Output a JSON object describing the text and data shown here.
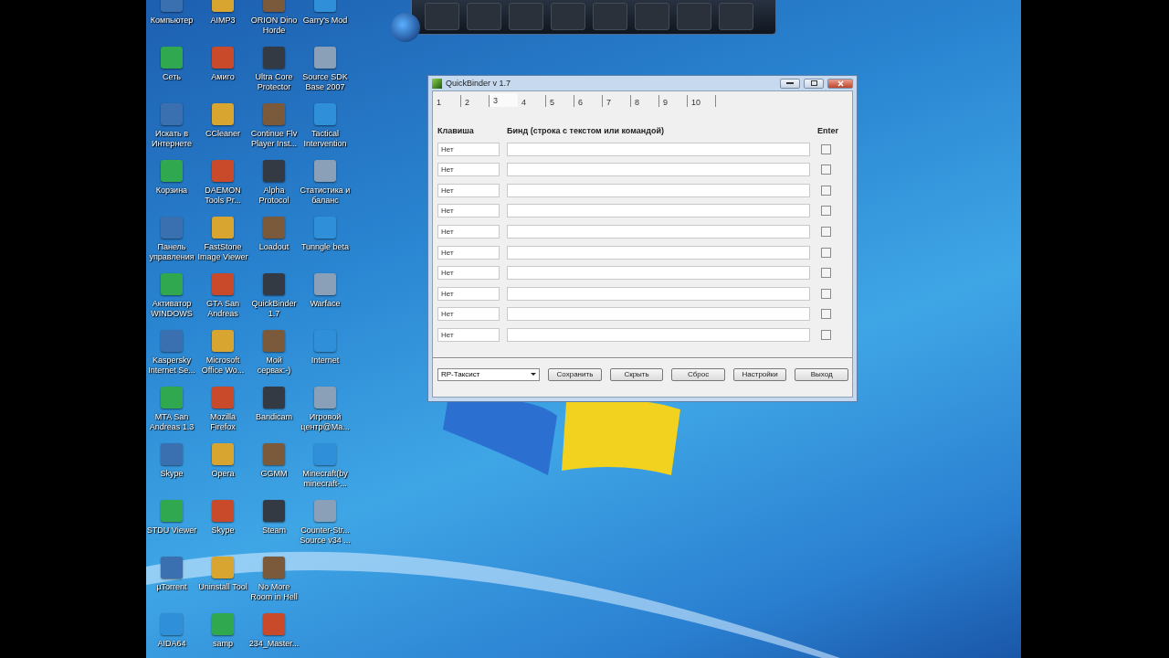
{
  "desktop": {
    "icon_rows": [
      [
        {
          "label": "Компьютер"
        },
        {
          "label": "AIMP3"
        },
        {
          "label": "ORION Dino Horde"
        },
        {
          "label": "Garry's Mod"
        }
      ],
      [
        {
          "label": "Сеть"
        },
        {
          "label": "Амиго"
        },
        {
          "label": "Ultra Core Protector"
        },
        {
          "label": "Source SDK Base 2007"
        }
      ],
      [
        {
          "label": "Искать в Интернете"
        },
        {
          "label": "CCleaner"
        },
        {
          "label": "Continue Flv Player Inst..."
        },
        {
          "label": "Tactical Intervention"
        }
      ],
      [
        {
          "label": "Корзина"
        },
        {
          "label": "DAEMON Tools Pr..."
        },
        {
          "label": "Alpha Protocol"
        },
        {
          "label": "Статистика и баланс"
        }
      ],
      [
        {
          "label": "Панель управления"
        },
        {
          "label": "FastStone Image Viewer"
        },
        {
          "label": "Loadout"
        },
        {
          "label": "Tunngle beta"
        }
      ],
      [
        {
          "label": "Активатор WINDOWS"
        },
        {
          "label": "GTA San Andreas"
        },
        {
          "label": "QuickBinder 1.7"
        },
        {
          "label": "Warface"
        }
      ],
      [
        {
          "label": "Kaspersky Internet Se..."
        },
        {
          "label": "Microsoft Office Wo..."
        },
        {
          "label": "Мой сервак:-)"
        },
        {
          "label": "Internet"
        }
      ],
      [
        {
          "label": "MTA San Andreas 1.3"
        },
        {
          "label": "Mozilla Firefox"
        },
        {
          "label": "Bandicam"
        },
        {
          "label": "Игровой центр@Ma..."
        }
      ],
      [
        {
          "label": "Skype"
        },
        {
          "label": "Opera"
        },
        {
          "label": "GGMM"
        },
        {
          "label": "Minecraft(by minecraft-..."
        }
      ],
      [
        {
          "label": "STDU Viewer"
        },
        {
          "label": "Skype"
        },
        {
          "label": "Steam"
        },
        {
          "label": "Counter-Str... Source v34 ..."
        }
      ],
      [
        {
          "label": "µTorrent"
        },
        {
          "label": "Uninstall Tool"
        },
        {
          "label": "No More Room in Hell"
        }
      ],
      [
        {
          "label": "AIDA64"
        },
        {
          "label": "samp"
        },
        {
          "label": "234_Master..."
        }
      ]
    ]
  },
  "window": {
    "title": "QuickBinder v 1.7",
    "tabs": [
      {
        "label": "1",
        "selected": false
      },
      {
        "label": "2",
        "selected": false
      },
      {
        "label": "3",
        "selected": true
      },
      {
        "label": "4",
        "selected": false
      },
      {
        "label": "5",
        "selected": false
      },
      {
        "label": "6",
        "selected": false
      },
      {
        "label": "7",
        "selected": false
      },
      {
        "label": "8",
        "selected": false
      },
      {
        "label": "9",
        "selected": false
      },
      {
        "label": "10",
        "selected": false
      }
    ],
    "columns": [
      "Клавиша",
      "Бинд (строка с текстом или командой)",
      "Enter"
    ],
    "rows": [
      {
        "key": "Нет",
        "enter": false
      },
      {
        "key": "Нет",
        "enter": false
      },
      {
        "key": "Нет",
        "enter": false
      },
      {
        "key": "Нет",
        "enter": false
      },
      {
        "key": "Нет",
        "enter": false
      },
      {
        "key": "Нет",
        "enter": false
      },
      {
        "key": "Нет",
        "enter": false
      },
      {
        "key": "Нет",
        "enter": false
      },
      {
        "key": "Нет",
        "enter": false
      },
      {
        "key": "Нет",
        "enter": false
      }
    ],
    "profile": "RP-Таксист",
    "buttons": [
      "Сохранить",
      "Скрыть",
      "Сброс",
      "Настройки",
      "Выход"
    ]
  }
}
